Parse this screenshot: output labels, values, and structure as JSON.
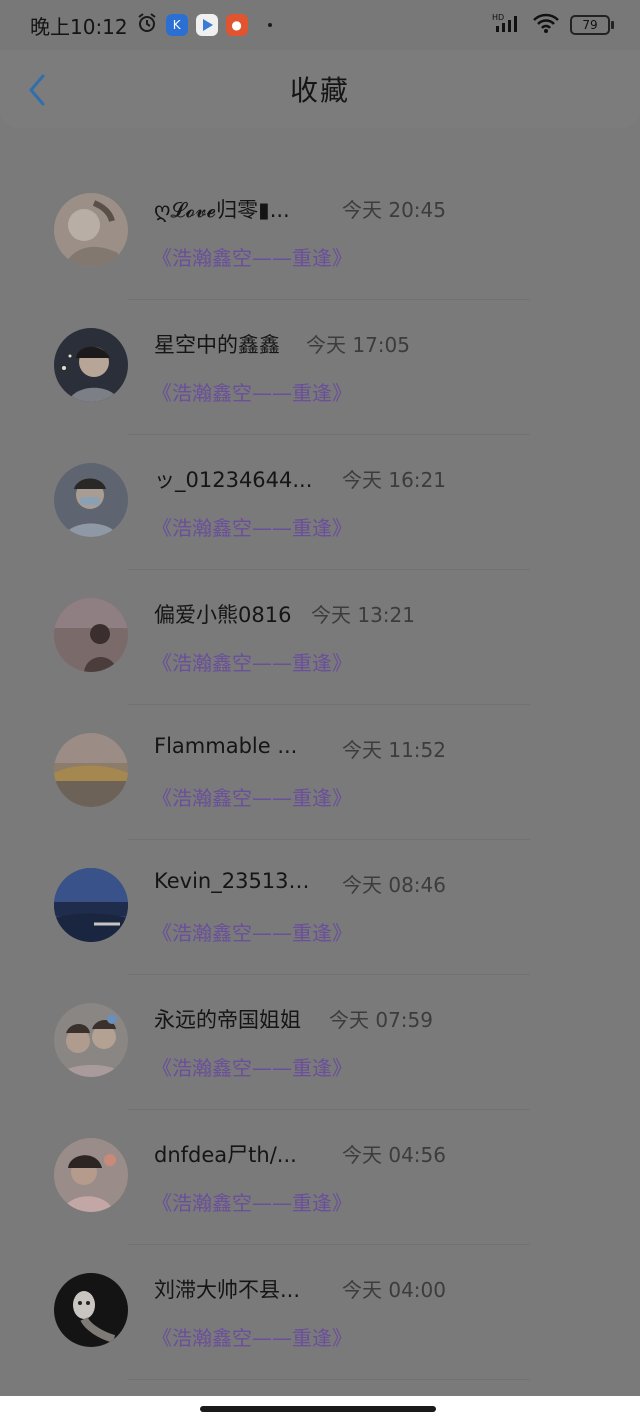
{
  "status": {
    "time": "晚上10:12",
    "battery": "79",
    "network": "HD"
  },
  "header": {
    "title": "收藏"
  },
  "items": [
    {
      "name": "ღ𝓛𝓸𝓿𝓮归零▮...",
      "time": "今天 20:45",
      "work": "《浩瀚鑫空——重逢》"
    },
    {
      "name": "星空中的鑫鑫",
      "time": "今天 17:05",
      "work": "《浩瀚鑫空——重逢》"
    },
    {
      "name": "ッ_01234644...",
      "time": "今天 16:21",
      "work": "《浩瀚鑫空——重逢》"
    },
    {
      "name": "偏爱小熊0816",
      "time": "今天 13:21",
      "work": "《浩瀚鑫空——重逢》"
    },
    {
      "name": "Flammable ...",
      "time": "今天 11:52",
      "work": "《浩瀚鑫空——重逢》"
    },
    {
      "name": "Kevin_235136...",
      "time": "今天 08:46",
      "work": "《浩瀚鑫空——重逢》"
    },
    {
      "name": "永远的帝国姐姐",
      "time": "今天 07:59",
      "work": "《浩瀚鑫空——重逢》"
    },
    {
      "name": "dnfdea尸th/...",
      "time": "今天 04:56",
      "work": "《浩瀚鑫空——重逢》"
    },
    {
      "name": "刘滞大帅不县...",
      "time": "今天 04:00",
      "work": "《浩瀚鑫空——重逢》"
    }
  ],
  "colors": {
    "accent": "#2f6fae",
    "work_link": "#6a4f9a"
  }
}
